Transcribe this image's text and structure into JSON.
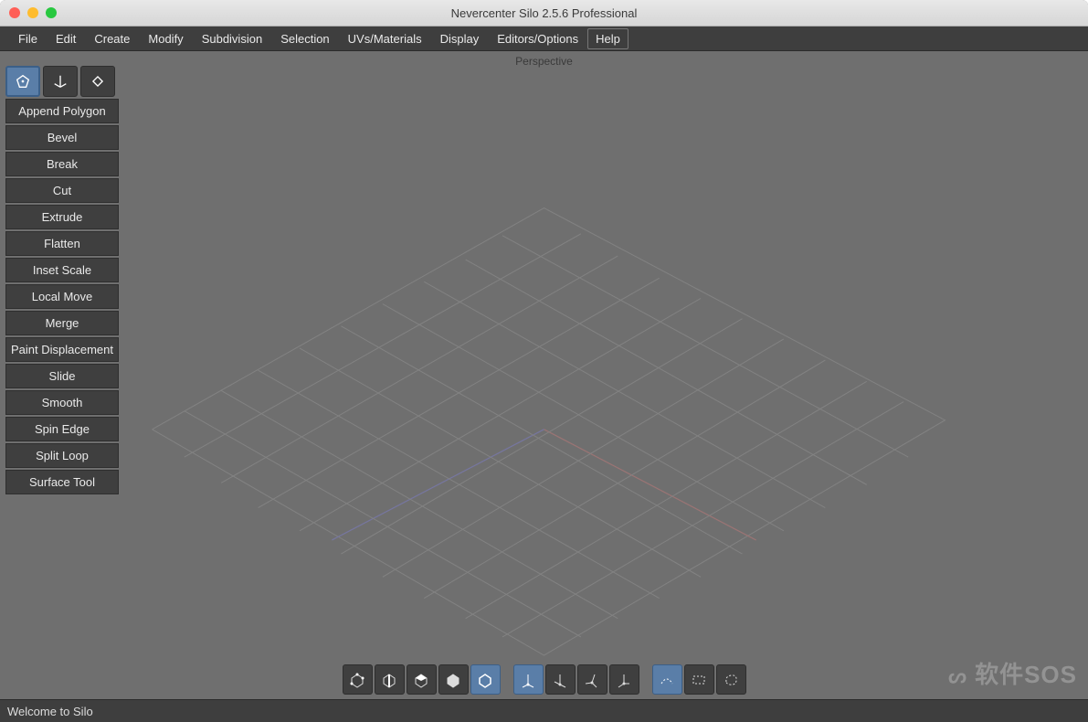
{
  "window": {
    "title": "Nevercenter Silo 2.5.6 Professional"
  },
  "menu": {
    "items": [
      "File",
      "Edit",
      "Create",
      "Modify",
      "Subdivision",
      "Selection",
      "UVs/Materials",
      "Display",
      "Editors/Options",
      "Help"
    ]
  },
  "viewport": {
    "label": "Perspective"
  },
  "tool_panel": {
    "tabs": [
      "mesh-tools",
      "transform-tools",
      "primitive-tools"
    ],
    "items": [
      "Append Polygon",
      "Bevel",
      "Break",
      "Cut",
      "Extrude",
      "Flatten",
      "Inset Scale",
      "Local Move",
      "Merge",
      "Paint Displacement",
      "Slide",
      "Smooth",
      "Spin Edge",
      "Split Loop",
      "Surface Tool"
    ]
  },
  "bottom_toolbar": {
    "group1": [
      "vertex-mode",
      "edge-mode",
      "face-mode",
      "object-mode",
      "multi-mode"
    ],
    "group2": [
      "manip-world",
      "manip-local",
      "manip-normal",
      "manip-screen"
    ],
    "group3": [
      "soft-select",
      "area-select",
      "lasso-select"
    ]
  },
  "status": {
    "text": "Welcome to Silo"
  },
  "watermark": "软件SOS"
}
